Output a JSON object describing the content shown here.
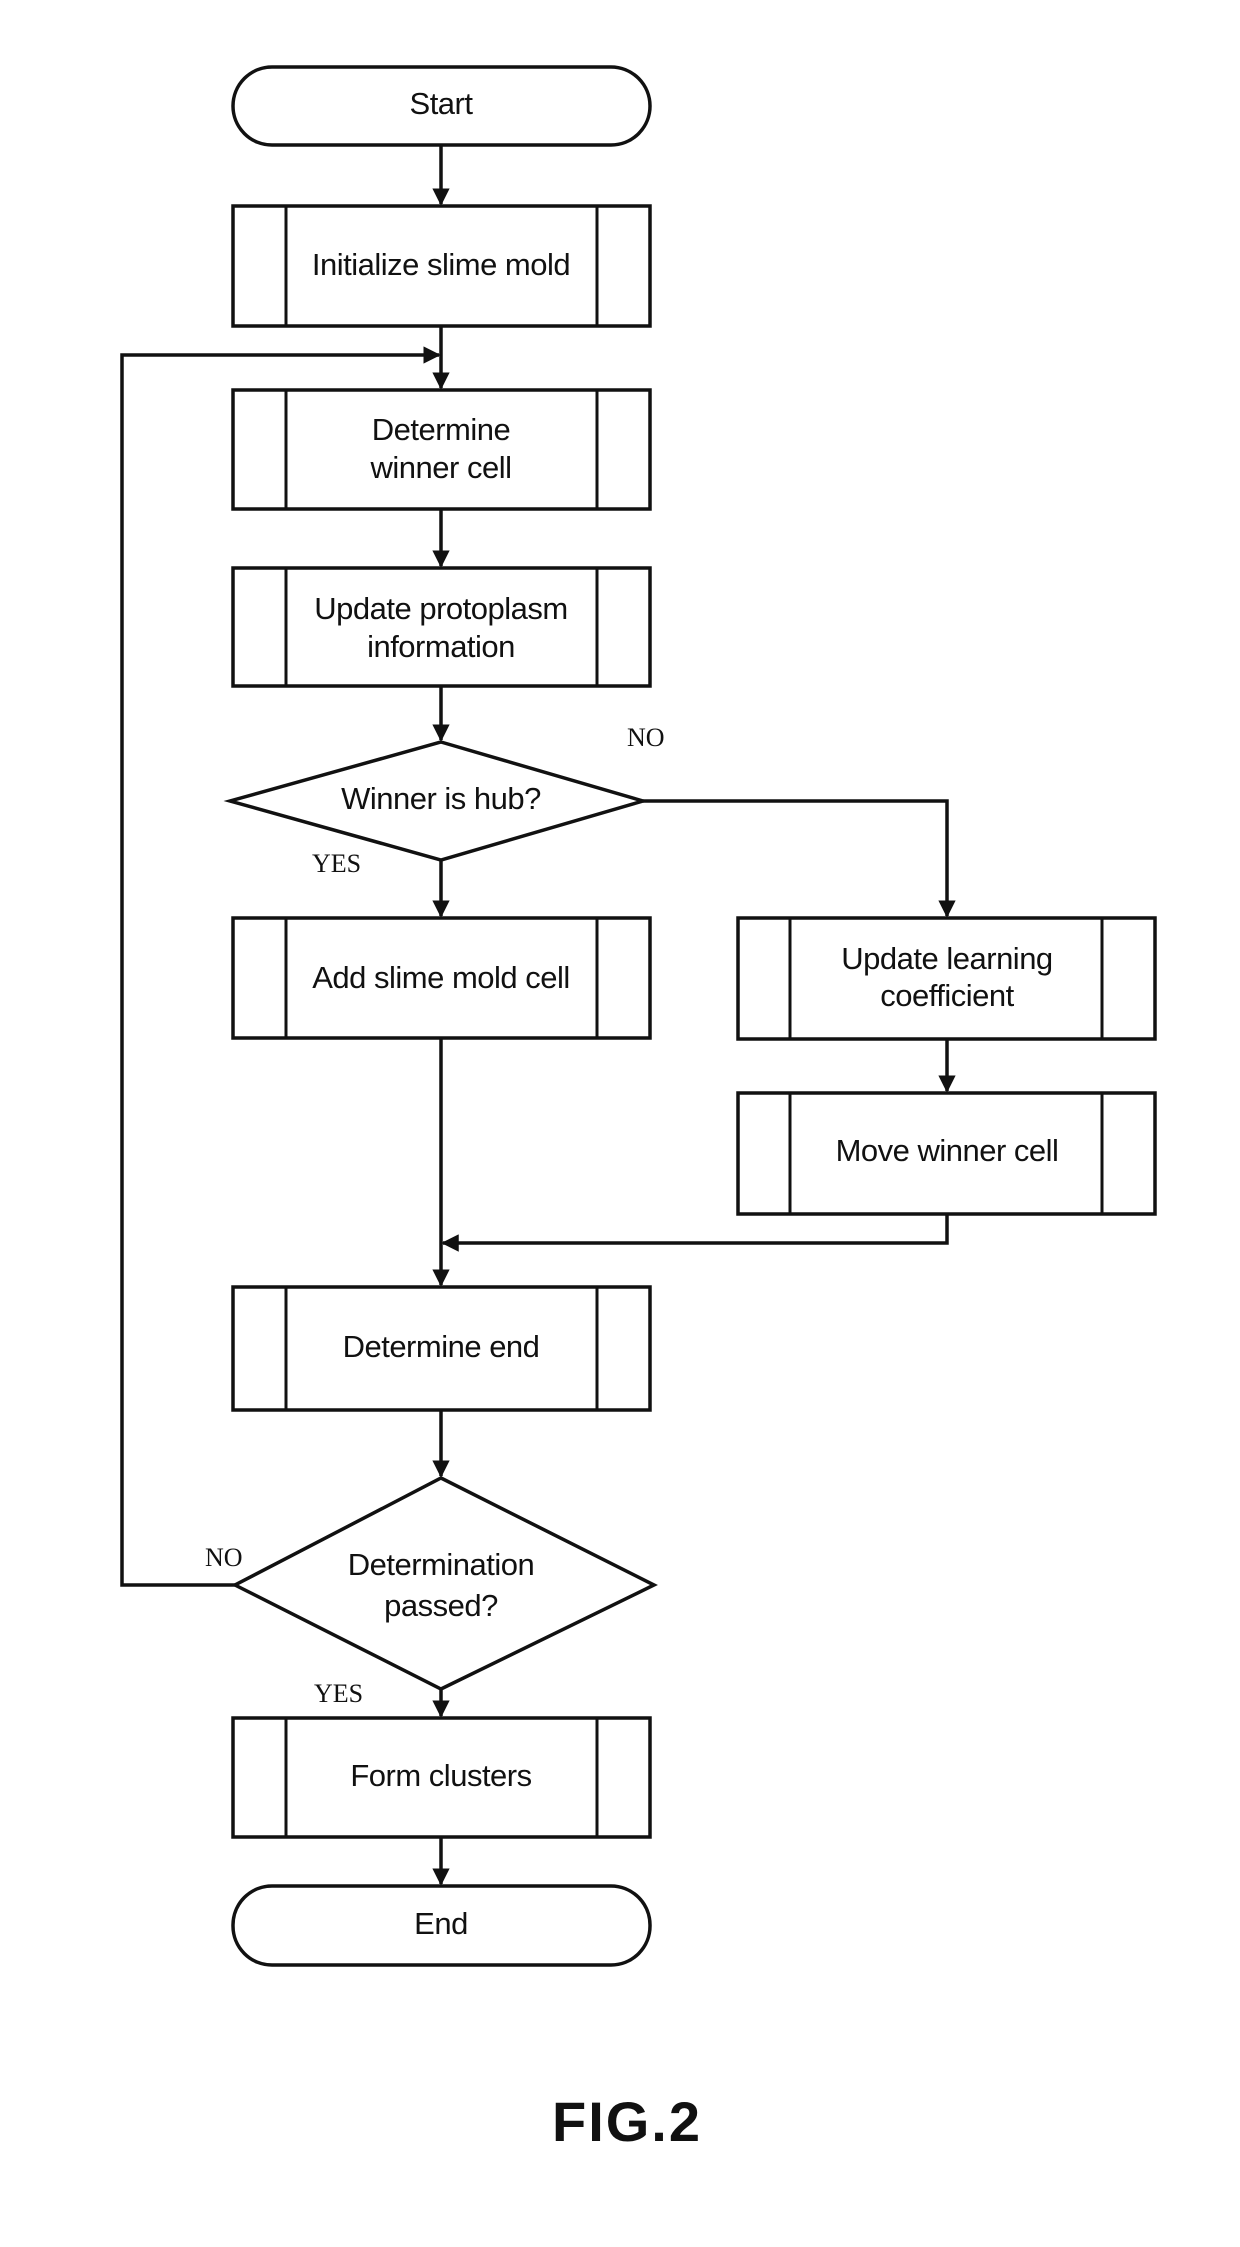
{
  "figure": {
    "label": "FIG.2",
    "type": "flowchart"
  },
  "nodes": {
    "start": {
      "shape": "terminator",
      "text": [
        "Start"
      ]
    },
    "init": {
      "shape": "predefined-process",
      "text": [
        "Initialize slime mold"
      ]
    },
    "winner": {
      "shape": "predefined-process",
      "text": [
        "Determine",
        "winner cell"
      ]
    },
    "proto": {
      "shape": "predefined-process",
      "text": [
        "Update protoplasm",
        "information"
      ]
    },
    "hub": {
      "shape": "decision",
      "text": [
        "Winner is hub?"
      ]
    },
    "add": {
      "shape": "predefined-process",
      "text": [
        "Add slime mold cell"
      ]
    },
    "learn": {
      "shape": "predefined-process",
      "text": [
        "Update learning",
        "coefficient"
      ]
    },
    "move": {
      "shape": "predefined-process",
      "text": [
        "Move winner cell"
      ]
    },
    "endcheck": {
      "shape": "predefined-process",
      "text": [
        "Determine end"
      ]
    },
    "passed": {
      "shape": "decision",
      "text": [
        "Determination",
        "passed?"
      ]
    },
    "clusters": {
      "shape": "predefined-process",
      "text": [
        "Form clusters"
      ]
    },
    "end": {
      "shape": "terminator",
      "text": [
        "End"
      ]
    }
  },
  "edges": [
    {
      "from": "start",
      "to": "init",
      "label": ""
    },
    {
      "from": "init",
      "to": "winner",
      "label": ""
    },
    {
      "from": "winner",
      "to": "proto",
      "label": ""
    },
    {
      "from": "proto",
      "to": "hub",
      "label": ""
    },
    {
      "from": "hub",
      "to": "add",
      "label": "YES"
    },
    {
      "from": "hub",
      "to": "learn",
      "label": "NO"
    },
    {
      "from": "learn",
      "to": "move",
      "label": ""
    },
    {
      "from": "move",
      "to": "endcheck",
      "label": ""
    },
    {
      "from": "add",
      "to": "endcheck",
      "label": ""
    },
    {
      "from": "endcheck",
      "to": "passed",
      "label": ""
    },
    {
      "from": "passed",
      "to": "clusters",
      "label": "YES"
    },
    {
      "from": "passed",
      "to": "winner",
      "label": "NO"
    },
    {
      "from": "clusters",
      "to": "end",
      "label": ""
    }
  ],
  "labels": {
    "hub_yes": "YES",
    "hub_no": "NO",
    "passed_yes": "YES",
    "passed_no": "NO"
  }
}
